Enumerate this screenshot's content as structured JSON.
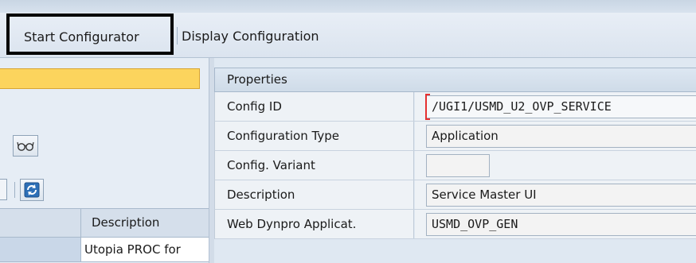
{
  "toolbar": {
    "start_configurator": "Start Configurator",
    "display_configuration": "Display Configuration"
  },
  "left_panel": {
    "grid": {
      "header_description": "Description",
      "rows": [
        {
          "description": "Utopia PROC for"
        }
      ]
    }
  },
  "properties": {
    "title": "Properties",
    "rows": [
      {
        "label": "Config ID",
        "value": "/UGI1/USMD_U2_OVP_SERVICE"
      },
      {
        "label": "Configuration Type",
        "value": "Application"
      },
      {
        "label": "Config. Variant",
        "value": ""
      },
      {
        "label": "Description",
        "value": "Service Master UI"
      },
      {
        "label": "Web Dynpro Applicat.",
        "value": "USMD_OVP_GEN"
      }
    ]
  },
  "icons": {
    "glasses": "glasses-icon",
    "refresh": "refresh-icon"
  },
  "colors": {
    "highlight_bar": "#fcd45d",
    "focus_marker": "#e53030",
    "frame_highlight": "#000000"
  }
}
